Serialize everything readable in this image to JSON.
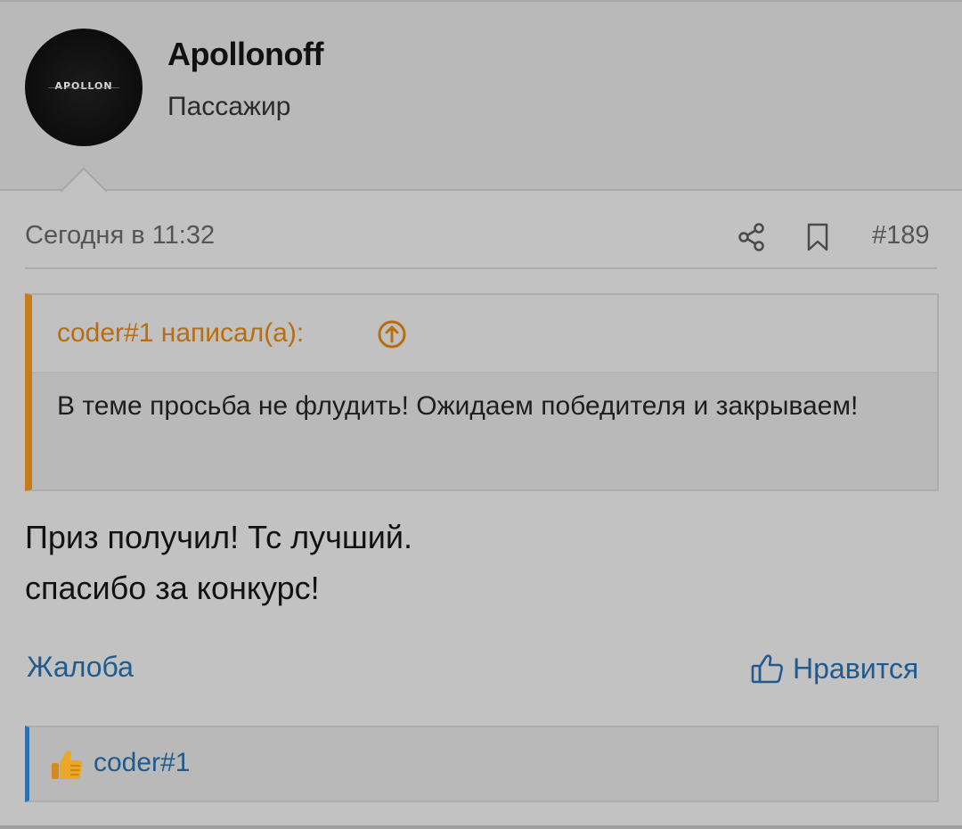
{
  "author": {
    "name": "Apollonoff",
    "role": "Пассажир",
    "avatar_text": "APOLLON"
  },
  "meta": {
    "date": "Сегодня в 11:32",
    "post_number": "#189",
    "share_icon": "share-icon",
    "bookmark_icon": "bookmark-icon"
  },
  "quote": {
    "author_label": "coder#1 написал(а):",
    "text": "В теме просьба не флудить! Ожидаем победителя и закрываем!",
    "accent_color": "#c97b1a"
  },
  "message": {
    "lines": [
      "Приз получил! Тс лучший.",
      "спасибо за конкурс!"
    ]
  },
  "actions": {
    "report_label": "Жалоба",
    "like_label": "Нравится",
    "link_color": "#205a8e"
  },
  "likes": {
    "users": [
      "coder#1"
    ],
    "accent_color": "#2f6fae"
  }
}
